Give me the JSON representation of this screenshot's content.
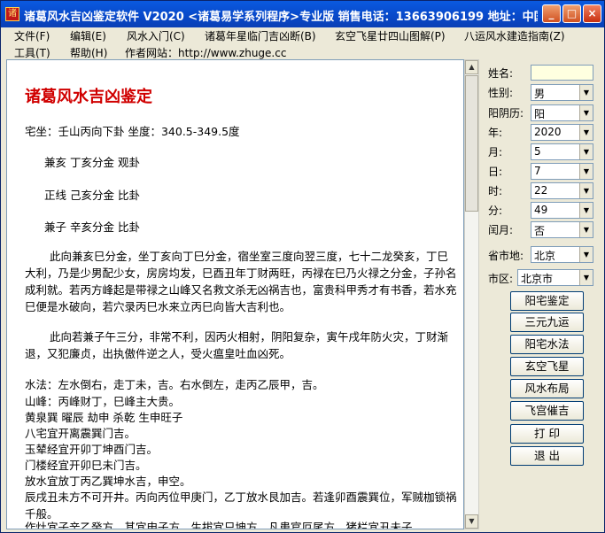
{
  "window": {
    "title": "诸葛风水吉凶鉴定软件 V2020 <诸葛易学系列程序>专业版   销售电话：13663906199   地址：中国北京...",
    "controls": {
      "minimize": "_",
      "maximize": "□",
      "close": "×"
    }
  },
  "menu": {
    "row1": [
      "文件(F)",
      "编辑(E)",
      "风水入门(C)",
      "诸葛年星临门吉凶断(B)",
      "玄空飞星廿四山图解(P)",
      "八运风水建造指南(Z)"
    ],
    "row2": [
      "工具(T)",
      "帮助(H)",
      "作者网站：http://www.zhuge.cc"
    ]
  },
  "content": {
    "heading": "诸葛风水吉凶鉴定",
    "zuo": "宅坐：壬山丙向下卦  坐度：340.5-349.5度",
    "jian_hai": "兼亥   丁亥分金 观卦",
    "zheng": "正线   己亥分金 比卦",
    "jian_zi": "兼子   辛亥分金 比卦",
    "p1": "此向兼亥巳分金，坐丁亥向丁巳分金，宿坐室三度向翌三度，七十二龙癸亥，丁巳大利，乃是少男配少女，房房均发，巳酉丑年丁财两旺，丙禄在巳乃火禄之分金，子孙名成利就。若丙方峰起是带禄之山峰又名救文杀无凶祸吉也，富贵科甲秀才有书香，若水充巳便是水破向，若穴录丙巳水来立丙巳向皆大吉利也。",
    "p2": "此向若兼子午三分，非常不利，因丙火相射，阴阳复杂，寅午戌年防火灾，丁财渐退，又犯廉贞，出执傲件逆之人，受火瘟皇吐血凶死。",
    "l1": "水法：左水倒右，走丁未，吉。右水倒左，走丙乙辰甲，吉。",
    "l2": "山峰：丙峰财丁，巳峰主大贵。",
    "l3": "黄泉巽 曜辰 劫申 杀乾 生申旺子",
    "l4": "八宅宜开离震巽门吉。",
    "l5": "玉辇经宜开卯丁坤酉门吉。",
    "l6": "门楼经宜开卯巳未门吉。",
    "l7": "放水宜放丁丙乙巽坤水吉，申空。",
    "l8": "辰戌丑未方不可开井。丙向丙位甲庚门，乙丁放水艮加吉。若逢卯酉震巽位，军贼枷锁祸千般。",
    "l9": "作灶宜子辛乙癸方，其宜申子方，生拔宜只坤方，凡患官厄尾方，猪栏宜丑未子"
  },
  "side": {
    "labels": {
      "name": "姓名:",
      "gender": "性别:",
      "calendar": "阳阴历:",
      "year": "年:",
      "month": "月:",
      "day": "日:",
      "hour": "时:",
      "minute": "分:",
      "leap": "闰月:",
      "province": "省市地:",
      "district": "市区:"
    },
    "values": {
      "name": "",
      "gender": "男",
      "calendar": "阳",
      "year": "2020",
      "month": "5",
      "day": "7",
      "hour": "22",
      "minute": "49",
      "leap": "否",
      "province": "北京",
      "district": "北京市"
    },
    "buttons": [
      "阳宅鉴定",
      "三元九运",
      "阳宅水法",
      "玄空飞星",
      "风水布局",
      "飞宫催吉",
      "打 印",
      "退 出"
    ]
  }
}
